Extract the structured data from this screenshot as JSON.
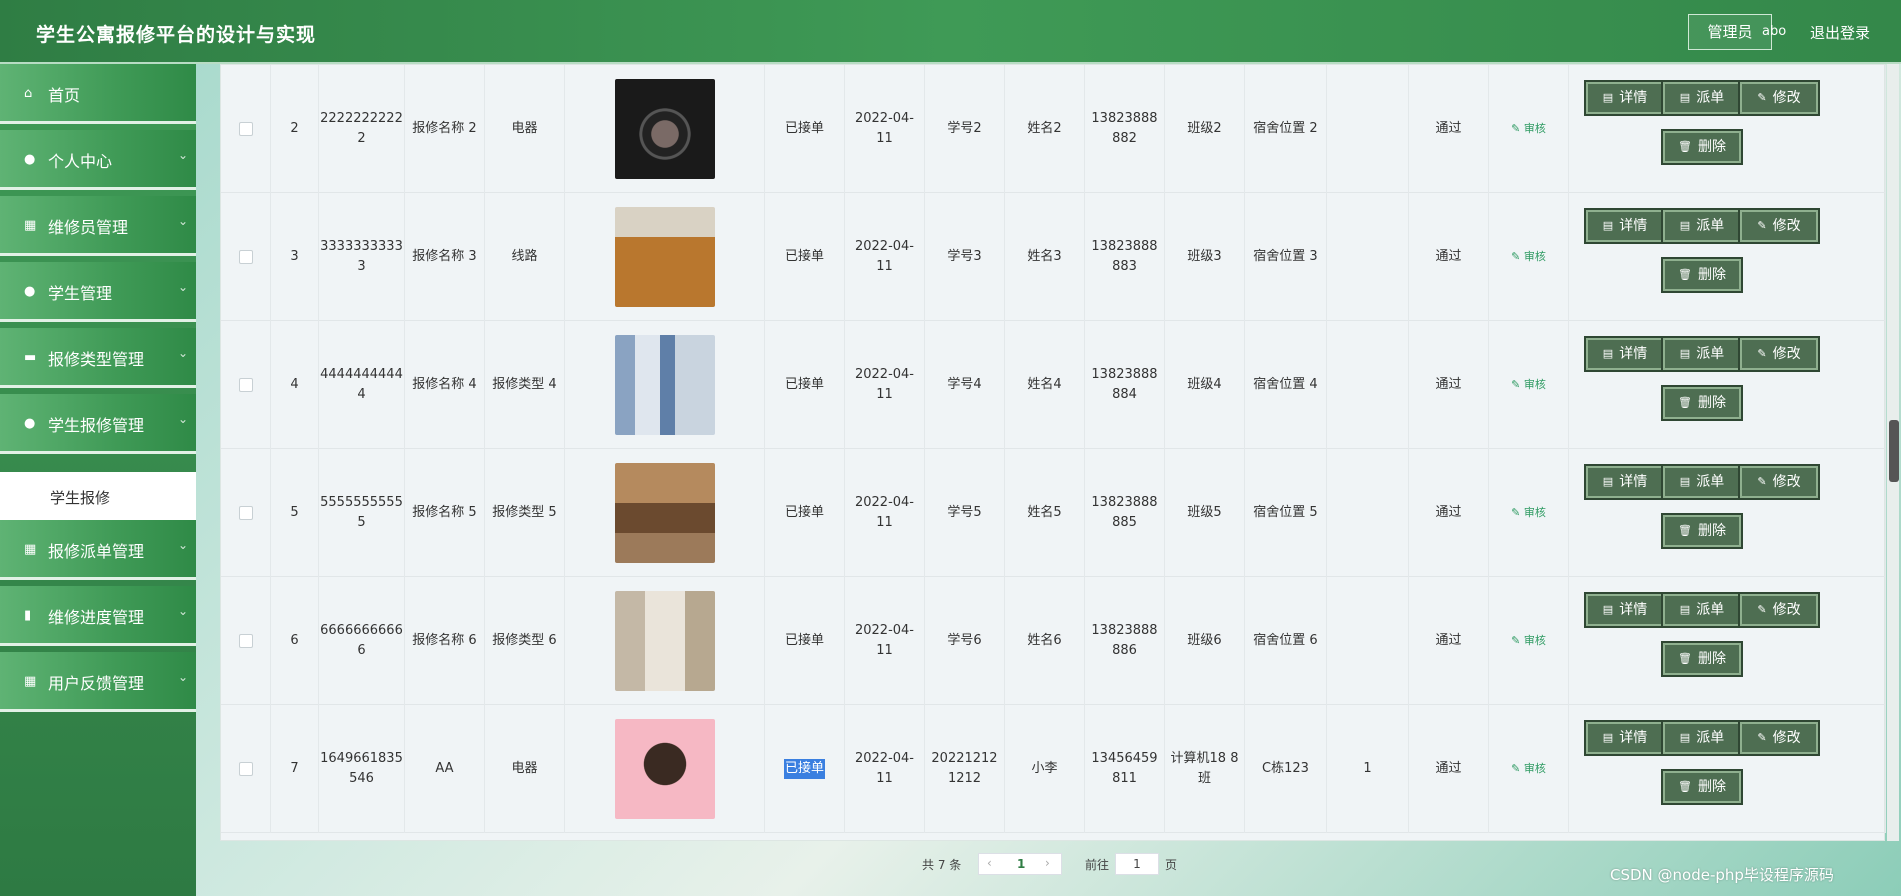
{
  "header": {
    "title": "学生公寓报修平台的设计与实现",
    "role": "管理员",
    "username": "abo",
    "logout": "退出登录"
  },
  "sidebar": {
    "items": [
      {
        "label": "首页",
        "icon": "home-icon"
      },
      {
        "label": "个人中心",
        "icon": "user-icon"
      },
      {
        "label": "维修员管理",
        "icon": "grid-icon"
      },
      {
        "label": "学生管理",
        "icon": "user-icon"
      },
      {
        "label": "报修类型管理",
        "icon": "id-card-icon"
      },
      {
        "label": "学生报修管理",
        "icon": "user-icon"
      },
      {
        "label": "报修派单管理",
        "icon": "grid-icon"
      },
      {
        "label": "维修进度管理",
        "icon": "bar-chart-icon"
      },
      {
        "label": "用户反馈管理",
        "icon": "grid-icon"
      }
    ],
    "active_submenu": "学生报修"
  },
  "table": {
    "rows": [
      {
        "index": "2",
        "number": "2222222222 2",
        "name": "报修名称 2",
        "type": "电器",
        "status": "已接单",
        "date": "2022-04- 11",
        "student_id": "学号2",
        "student_name": "姓名2",
        "phone": "13823888 882",
        "class": "班级2",
        "location": "宿舍位置 2",
        "count": "",
        "review": "通过",
        "photo": "washer"
      },
      {
        "index": "3",
        "number": "3333333333 3",
        "name": "报修名称 3",
        "type": "线路",
        "status": "已接单",
        "date": "2022-04- 11",
        "student_id": "学号3",
        "student_name": "姓名3",
        "phone": "13823888 883",
        "class": "班级3",
        "location": "宿舍位置 3",
        "count": "",
        "review": "通过",
        "photo": "dorm-wood"
      },
      {
        "index": "4",
        "number": "4444444444 4",
        "name": "报修名称 4",
        "type": "报修类型 4",
        "status": "已接单",
        "date": "2022-04- 11",
        "student_id": "学号4",
        "student_name": "姓名4",
        "phone": "13823888 884",
        "class": "班级4",
        "location": "宿舍位置 4",
        "count": "",
        "review": "通过",
        "photo": "dorm-blue"
      },
      {
        "index": "5",
        "number": "5555555555 5",
        "name": "报修名称 5",
        "type": "报修类型 5",
        "status": "已接单",
        "date": "2022-04- 11",
        "student_id": "学号5",
        "student_name": "姓名5",
        "phone": "13823888 885",
        "class": "班级5",
        "location": "宿舍位置 5",
        "count": "",
        "review": "通过",
        "photo": "dorm-brown"
      },
      {
        "index": "6",
        "number": "6666666666 6",
        "name": "报修名称 6",
        "type": "报修类型 6",
        "status": "已接单",
        "date": "2022-04- 11",
        "student_id": "学号6",
        "student_name": "姓名6",
        "phone": "13823888 886",
        "class": "班级6",
        "location": "宿舍位置 6",
        "count": "",
        "review": "通过",
        "photo": "dorm-hall"
      },
      {
        "index": "7",
        "number": "1649661835 546",
        "name": "AA",
        "type": "电器",
        "status": "已接单",
        "date": "2022-04- 11",
        "student_id": "20221212 1212",
        "student_name": "小李",
        "phone": "13456459 811",
        "class": "计算机18 8班",
        "location": "C栋123",
        "count": "1",
        "review": "通过",
        "photo": "monkey"
      }
    ],
    "audit_label": "审核",
    "buttons": {
      "detail": "详情",
      "dispatch": "派单",
      "edit": "修改",
      "delete": "删除"
    }
  },
  "pagination": {
    "total_text": "共 7 条",
    "current_page": "1",
    "goto_label": "前往",
    "goto_value": "1",
    "page_suffix": "页"
  },
  "watermark": "CSDN @node-php毕设程序源码",
  "colors": {
    "header": "#3f9a56",
    "button": "#4e6e52",
    "audit": "#2f9b63",
    "highlight": "#3a7fe0"
  }
}
